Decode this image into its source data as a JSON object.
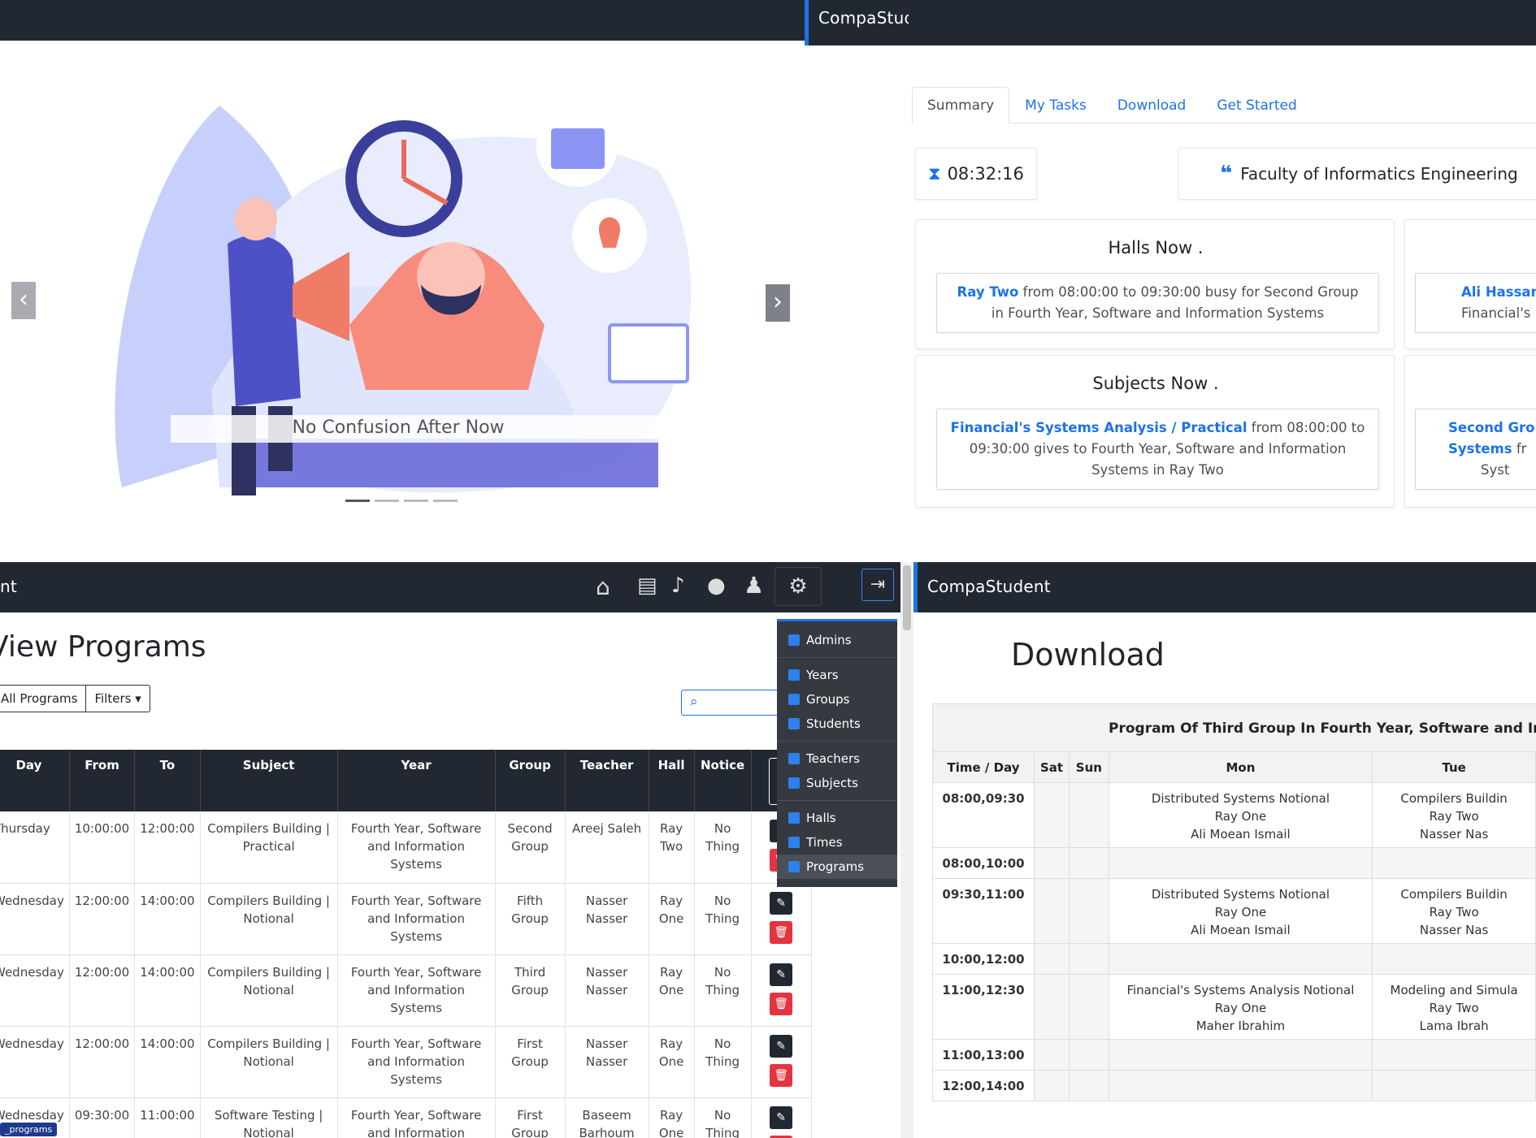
{
  "top_left": {
    "brand": "CompaStudent",
    "carousel_caption": "No Confusion After Now",
    "prev_icon": "chevron-left-icon",
    "next_icon": "chevron-right-icon",
    "indicators": 4,
    "active_indicator": 1
  },
  "top_right": {
    "tabs": [
      "Summary",
      "My Tasks",
      "Download",
      "Get Started"
    ],
    "active_tab": "Summary",
    "clock": "08:32:16",
    "faculty": "Faculty of Informatics Engineering",
    "halls_title": "Halls Now .",
    "halls_notice": {
      "bold": "Ray Two",
      "text": " from 08:00:00 to 09:30:00 busy for Second Group in Fourth Year, Software and Information Systems"
    },
    "halls_notice2": {
      "bold": "Ali Hassan",
      "text": "Financial's"
    },
    "subjects_title": "Subjects Now .",
    "subjects_notice": {
      "bold": "Financial's Systems Analysis / Practical",
      "text": " from 08:00:00 to 09:30:00 gives to Fourth Year, Software and Information Systems in Ray Two"
    },
    "subjects_notice2": {
      "bold1": "Second Gro",
      "bold2": "Systems",
      "text2": "fr",
      "text3": "Syst"
    }
  },
  "bottom_left": {
    "brand_fragment": "nt",
    "page_title": "View Programs",
    "btn_all": "All Programs",
    "btn_filters": "Filters",
    "menu": [
      {
        "label": "Admins",
        "group": 1
      },
      {
        "label": "Years",
        "group": 2
      },
      {
        "label": "Groups",
        "group": 2
      },
      {
        "label": "Students",
        "group": 2
      },
      {
        "label": "Teachers",
        "group": 3
      },
      {
        "label": "Subjects",
        "group": 3
      },
      {
        "label": "Halls",
        "group": 4
      },
      {
        "label": "Times",
        "group": 4
      },
      {
        "label": "Programs",
        "group": 4
      }
    ],
    "active_menu": "Programs",
    "columns": [
      "Day",
      "From",
      "To",
      "Subject",
      "Year",
      "Group",
      "Teacher",
      "Hall",
      "Notice"
    ],
    "rows": [
      [
        "Thursday",
        "10:00:00",
        "12:00:00",
        "Compilers Building | Practical",
        "Fourth Year, Software and Information Systems",
        "Second Group",
        "Areej Saleh",
        "Ray Two",
        "No Thing"
      ],
      [
        "Wednesday",
        "12:00:00",
        "14:00:00",
        "Compilers Building | Notional",
        "Fourth Year, Software and Information Systems",
        "Fifth Group",
        "Nasser Nasser",
        "Ray One",
        "No Thing"
      ],
      [
        "Wednesday",
        "12:00:00",
        "14:00:00",
        "Compilers Building | Notional",
        "Fourth Year, Software and Information Systems",
        "Third Group",
        "Nasser Nasser",
        "Ray One",
        "No Thing"
      ],
      [
        "Wednesday",
        "12:00:00",
        "14:00:00",
        "Compilers Building | Notional",
        "Fourth Year, Software and Information Systems",
        "First Group",
        "Nasser Nasser",
        "Ray One",
        "No Thing"
      ],
      [
        "Wednesday",
        "09:30:00",
        "11:00:00",
        "Software Testing | Notional",
        "Fourth Year, Software and Information Systems",
        "First Group",
        "Baseem Barhoum",
        "Ray One",
        "No Thing"
      ]
    ],
    "url_badge": "_programs"
  },
  "bottom_right": {
    "brand": "CompaStudent",
    "title": "Download",
    "program_title": "Program Of Third Group In Fourth Year, Software and Info",
    "columns": [
      "Time / Day",
      "Sat",
      "Sun",
      "Mon",
      "Tue"
    ],
    "rows": [
      {
        "time": "08:00,09:30",
        "mon": [
          "Distributed Systems Notional",
          "Ray One",
          "Ali Moean Ismail"
        ],
        "tue": [
          "Compilers Buildin",
          "Ray Two",
          "Nasser Nas"
        ]
      },
      {
        "time": "08:00,10:00",
        "mon": [],
        "tue": []
      },
      {
        "time": "09:30,11:00",
        "mon": [
          "Distributed Systems Notional",
          "Ray One",
          "Ali Moean Ismail"
        ],
        "tue": [
          "Compilers Buildin",
          "Ray Two",
          "Nasser Nas"
        ]
      },
      {
        "time": "10:00,12:00",
        "mon": [],
        "tue": []
      },
      {
        "time": "11:00,12:30",
        "mon": [
          "Financial's Systems Analysis Notional",
          "Ray One",
          "Maher Ibrahim"
        ],
        "tue": [
          "Modeling and Simula",
          "Ray Two",
          "Lama Ibrah"
        ]
      },
      {
        "time": "11:00,13:00",
        "mon": [],
        "tue": []
      },
      {
        "time": "12:00,14:00",
        "mon": [],
        "tue": []
      }
    ]
  },
  "colors": {
    "navbar": "#222831",
    "accent": "#1d72e8",
    "danger": "#e3343f"
  }
}
